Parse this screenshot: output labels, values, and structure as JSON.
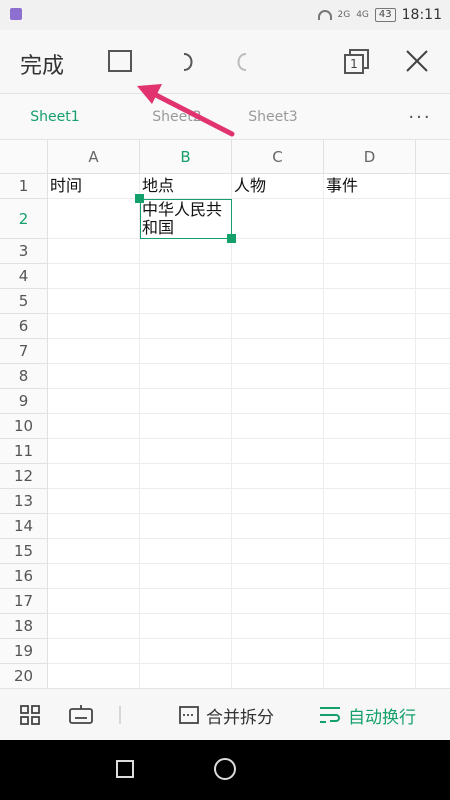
{
  "status_bar": {
    "network_1": "2G",
    "network_2": "4G",
    "battery": "43",
    "time": "18:11"
  },
  "toolbar": {
    "done_label": "完成",
    "windows_count": "1"
  },
  "sheet_tabs": [
    {
      "label": "Sheet1",
      "active": true
    },
    {
      "label": "Sheet2",
      "active": false
    },
    {
      "label": "Sheet3",
      "active": false
    }
  ],
  "more_label": "···",
  "columns": [
    "A",
    "B",
    "C",
    "D"
  ],
  "rows": [
    "1",
    "2",
    "3",
    "4",
    "5",
    "6",
    "7",
    "8",
    "9",
    "10",
    "11",
    "12",
    "13",
    "14",
    "15",
    "16",
    "17",
    "18",
    "19",
    "20"
  ],
  "cells": {
    "A1": "时间",
    "B1": "地点",
    "C1": "人物",
    "D1": "事件",
    "B2": "中华人民共和国"
  },
  "selected_cell": "B2",
  "bottom_toolbar": {
    "merge_label": "合并拆分",
    "wrap_label": "自动换行"
  },
  "colors": {
    "accent": "#14a06a",
    "annotation_arrow": "#e0336f"
  },
  "icons": [
    "save-icon",
    "undo-icon",
    "redo-icon",
    "windows-icon",
    "close-icon",
    "apps-icon",
    "keyboard-icon",
    "merge-icon",
    "wrap-text-icon"
  ]
}
